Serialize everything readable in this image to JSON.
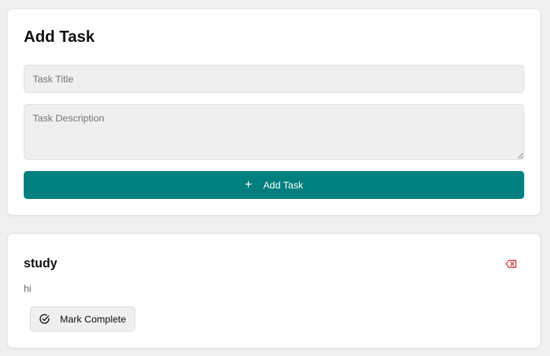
{
  "add_task_form": {
    "heading": "Add Task",
    "title_placeholder": "Task Title",
    "title_value": "",
    "description_placeholder": "Task Description",
    "description_value": "",
    "submit_label": "Add Task",
    "submit_icon": "plus-icon",
    "accent_color": "#017f7e"
  },
  "tasks": [
    {
      "title": "study",
      "description": "hi",
      "delete_icon": "backspace-icon",
      "delete_color": "#d9303a",
      "complete_label": "Mark Complete",
      "complete_icon": "circle-check-icon"
    }
  ]
}
